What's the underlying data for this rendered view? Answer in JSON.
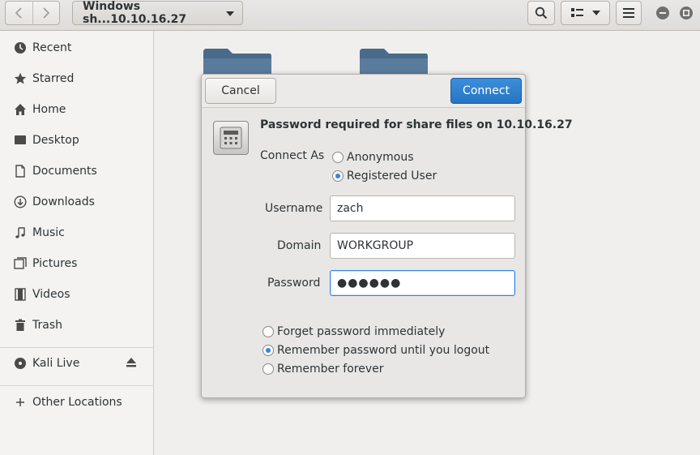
{
  "headerbar": {
    "path_label": "Windows sh...10.10.16.27",
    "icons": [
      "back-arrow-icon",
      "forward-arrow-icon",
      "search-icon",
      "list-view-icon",
      "chevron-down-icon",
      "menu-icon",
      "minimize-icon",
      "maximize-icon"
    ]
  },
  "sidebar": {
    "items": [
      {
        "label": "Recent",
        "icon": "clock-icon"
      },
      {
        "label": "Starred",
        "icon": "star-icon"
      },
      {
        "label": "Home",
        "icon": "home-icon"
      },
      {
        "label": "Desktop",
        "icon": "desktop-icon"
      },
      {
        "label": "Documents",
        "icon": "document-icon"
      },
      {
        "label": "Downloads",
        "icon": "download-icon"
      },
      {
        "label": "Music",
        "icon": "music-note-icon"
      },
      {
        "label": "Pictures",
        "icon": "pictures-icon"
      },
      {
        "label": "Videos",
        "icon": "film-icon"
      },
      {
        "label": "Trash",
        "icon": "trash-icon"
      }
    ],
    "devices": [
      {
        "label": "Kali Live",
        "icon": "disc-icon",
        "action_icon": "eject-icon"
      }
    ],
    "other": {
      "label": "Other Locations",
      "icon": "plus-icon"
    }
  },
  "dialog": {
    "cancel_label": "Cancel",
    "connect_label": "Connect",
    "title": "Password required for share files on 10.10.16.27",
    "connect_as_label": "Connect As",
    "connect_as_options": [
      {
        "label": "Anonymous",
        "checked": false
      },
      {
        "label": "Registered User",
        "checked": true
      }
    ],
    "username_label": "Username",
    "username_value": "zach",
    "domain_label": "Domain",
    "domain_value": "WORKGROUP",
    "password_label": "Password",
    "password_value": "●●●●●●",
    "remember_options": [
      {
        "label": "Forget password immediately",
        "checked": false
      },
      {
        "label": "Remember password until you logout",
        "checked": true
      },
      {
        "label": "Remember forever",
        "checked": false
      }
    ]
  },
  "colors": {
    "accent": "#3584e4",
    "connect_button": "#2a7bcc",
    "folder": "#4a6a8a"
  }
}
